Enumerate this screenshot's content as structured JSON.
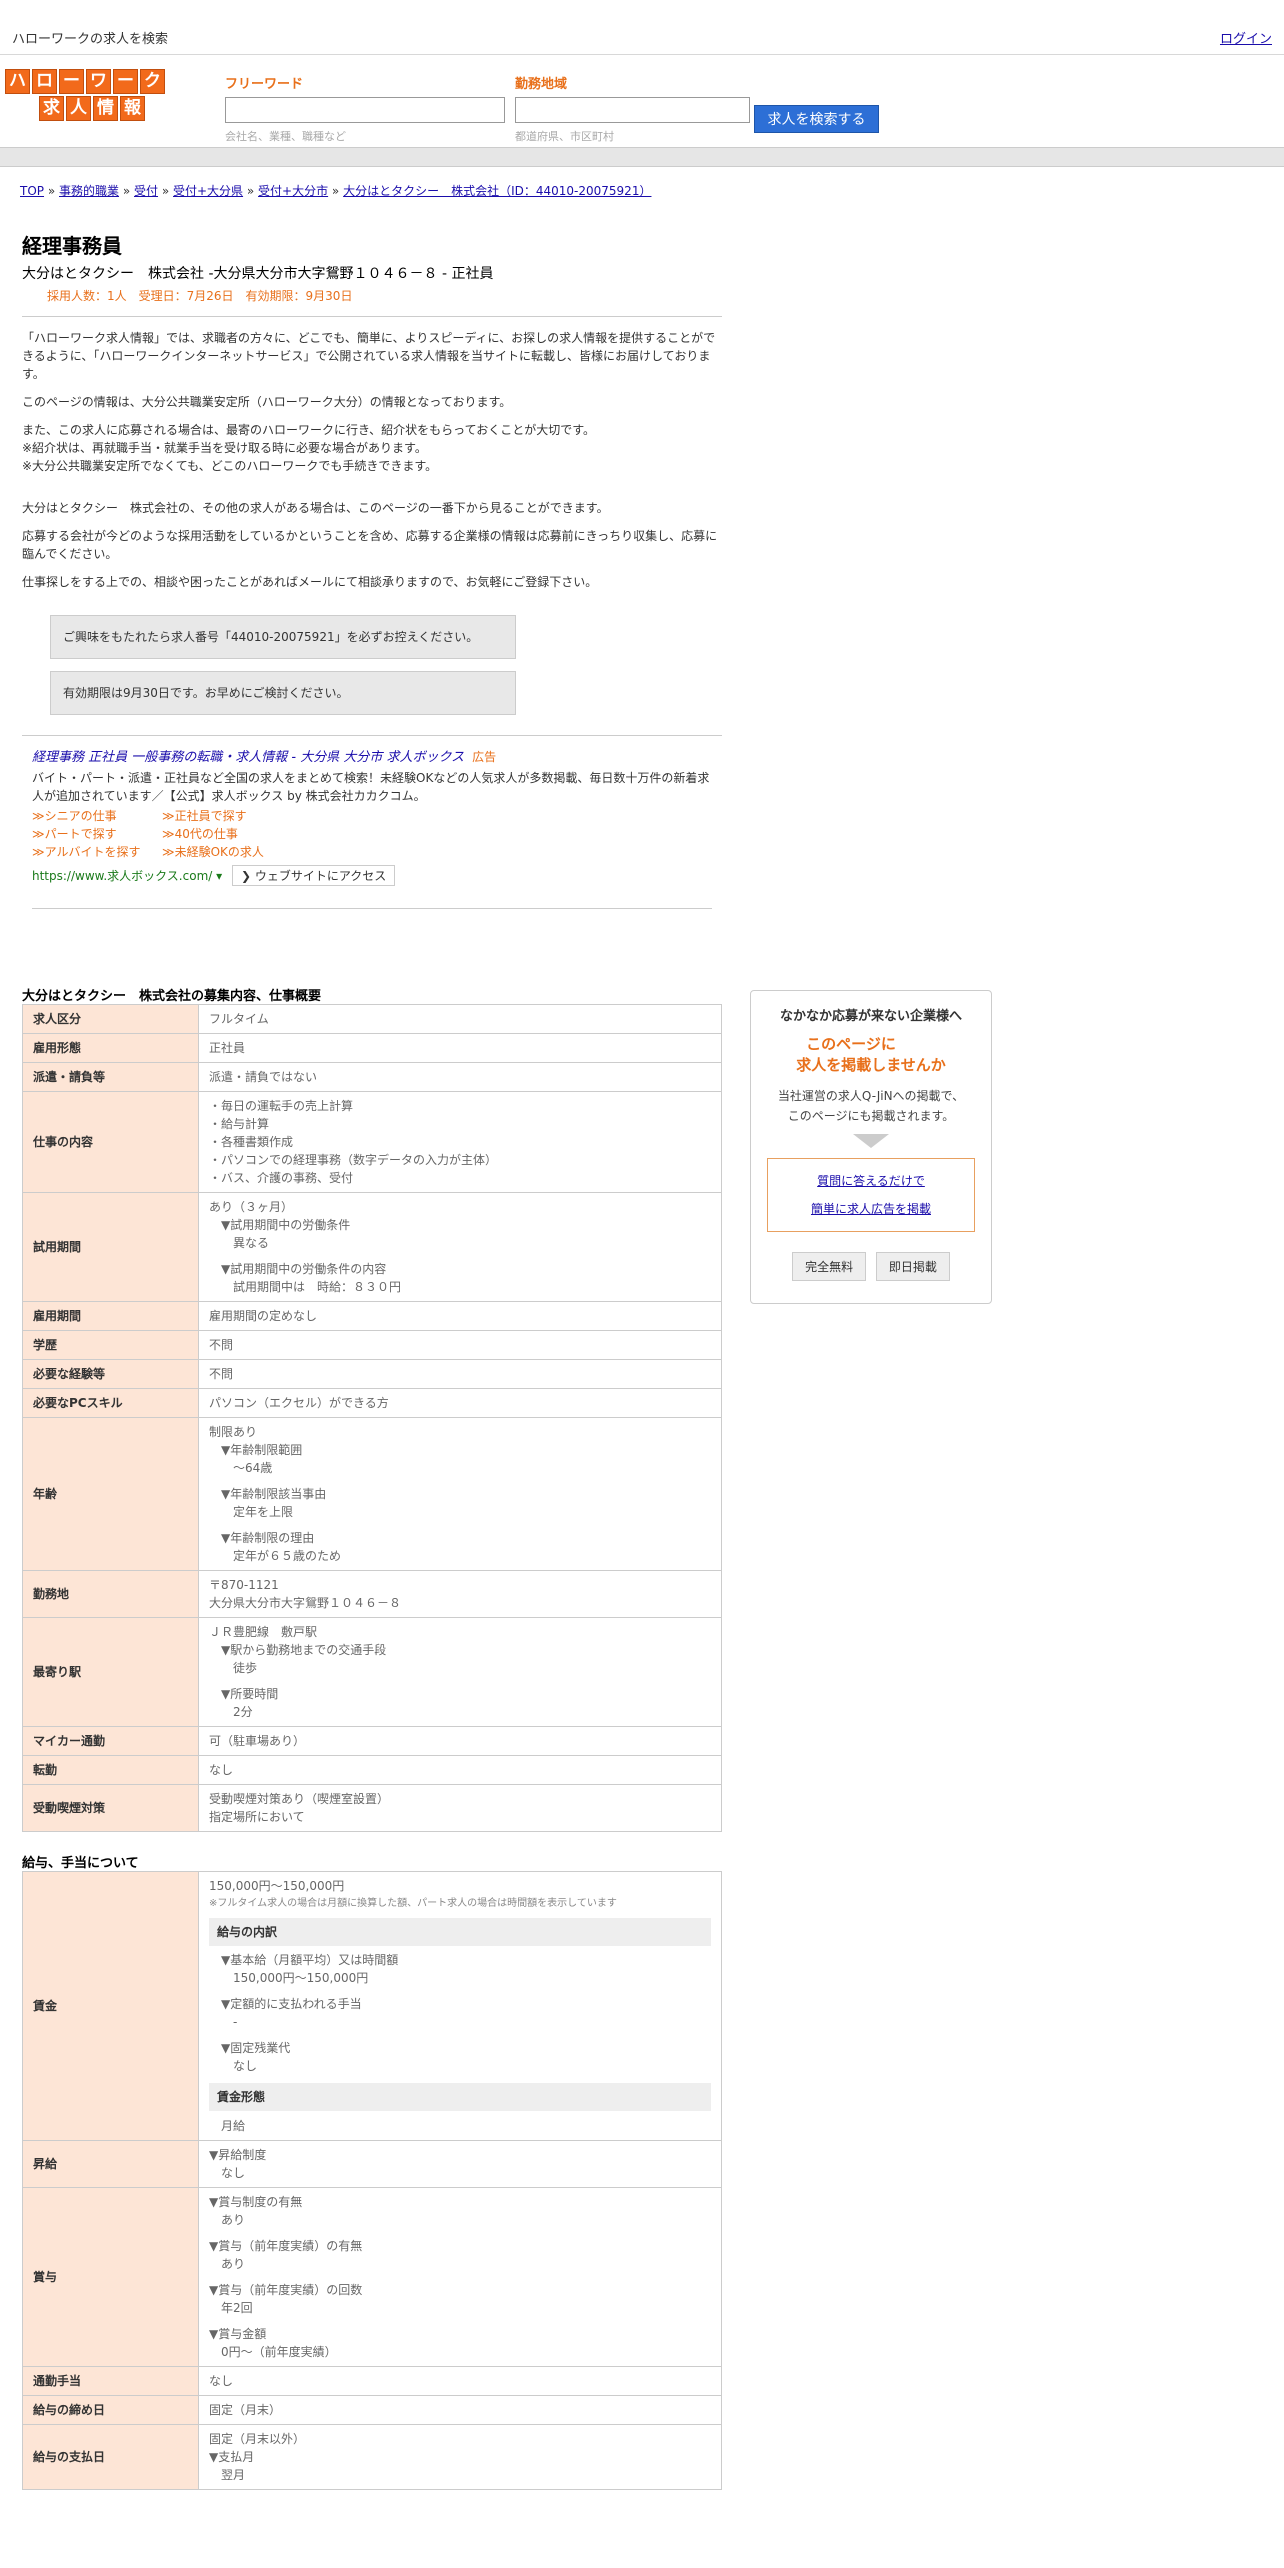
{
  "topbar": {
    "title": "ハローワークの求人を検索",
    "login": "ログイン"
  },
  "logo": {
    "top": [
      "ハ",
      "ロ",
      "ー",
      "ワ",
      "ー",
      "ク"
    ],
    "bottom": [
      "求",
      "人",
      "情",
      "報"
    ]
  },
  "search": {
    "keyword_label": "フリーワード",
    "keyword_hint": "会社名、業種、職種など",
    "area_label": "勤務地域",
    "area_hint": "都道府県、市区町村",
    "button": "求人を検索する"
  },
  "breadcrumb": [
    "TOP",
    "事務的職業",
    "受付",
    "受付+大分県",
    "受付+大分市",
    "大分はとタクシー　株式会社（ID：44010-20075921）"
  ],
  "job": {
    "title": "経理事務員",
    "subtitle": "大分はとタクシー　株式会社 -大分県大分市大字鴛野１０４６－８ - 正社員",
    "meta": "採用人数：1人　受理日：7月26日　有効期限：9月30日"
  },
  "intro": {
    "p1": "「ハローワーク求人情報」では、求職者の方々に、どこでも、簡単に、よりスピーディに、お探しの求人情報を提供することができるように、「ハローワークインターネットサービス」で公開されている求人情報を当サイトに転載し、皆様にお届けしております。",
    "p2": "このページの情報は、大分公共職業安定所（ハローワーク大分）の情報となっております。",
    "p3": "また、この求人に応募される場合は、最寄のハローワークに行き、紹介状をもらっておくことが大切です。",
    "p4": "※紹介状は、再就職手当・就業手当を受け取る時に必要な場合があります。",
    "p5": "※大分公共職業安定所でなくても、どこのハローワークでも手続きできます。",
    "p6": "大分はとタクシー　株式会社の、その他の求人がある場合は、このページの一番下から見ることができます。",
    "p7": "応募する会社が今どのような採用活動をしているかということを含め、応募する企業様の情報は応募前にきっちり収集し、応募に臨んでください。",
    "p8": "仕事探しをする上での、相談や困ったことがあればメールにて相談承りますので、お気軽にご登録下さい。"
  },
  "notes": [
    "ご興味をもたれたら求人番号「44010-20075921」を必ずお控えください。",
    "有効期限は9月30日です。お早めにご検討ください。"
  ],
  "ad": {
    "title": "経理事務 正社員 一般事務の転職・求人情報 - 大分県 大分市 求人ボックス",
    "label": "広告",
    "desc": "バイト・パート・派遣・正社員など全国の求人をまとめて検索！未経験OKなどの人気求人が多数掲載、毎日数十万件の新着求人が追加されています／【公式】求人ボックス by 株式会社カカクコム。",
    "links": [
      "≫シニアの仕事",
      "≫正社員で探す",
      "≫パートで探す",
      "≫40代の仕事",
      "≫アルバイトを探す",
      "≫未経験OKの求人"
    ],
    "url": "https://www.求人ボックス.com/",
    "visit": "❯ ウェブサイトにアクセス"
  },
  "section1": {
    "heading": "大分はとタクシー　株式会社の募集内容、仕事概要"
  },
  "section2": {
    "heading": "給与、手当について"
  },
  "rows": {
    "kubun": [
      "求人区分",
      "フルタイム"
    ],
    "koyou": [
      "雇用形態",
      "正社員"
    ],
    "haken": [
      "派遣・請負等",
      "派遣・請負ではない"
    ],
    "naiyou": [
      "仕事の内容",
      "・毎日の運転手の売上計算",
      "・給与計算",
      "・各種書類作成",
      "・パソコンでの経理事務（数字データの入力が主体）",
      "・バス、介護の事務、受付"
    ],
    "shiyou": [
      "試用期間",
      "あり（３ヶ月）",
      "▼試用期間中の労働条件",
      "異なる",
      "▼試用期間中の労働条件の内容",
      "試用期間中は　時給：８３０円"
    ],
    "kikan": [
      "雇用期間",
      "雇用期間の定めなし"
    ],
    "gakureki": [
      "学歴",
      "不問"
    ],
    "keiken": [
      "必要な経験等",
      "不問"
    ],
    "pc": [
      "必要なPCスキル",
      "パソコン（エクセル）ができる方"
    ],
    "nenrei": [
      "年齢",
      "制限あり",
      "▼年齢制限範囲",
      "〜64歳",
      "▼年齢制限該当事由",
      "定年を上限",
      "▼年齢制限の理由",
      "定年が６５歳のため"
    ],
    "kinmu": [
      "勤務地",
      "〒870-1121",
      "大分県大分市大字鴛野１０４６－８"
    ],
    "eki": [
      "最寄り駅",
      "ＪＲ豊肥線　敷戸駅",
      "▼駅から勤務地までの交通手段",
      "徒歩",
      "▼所要時間",
      "2分"
    ],
    "mycar": [
      "マイカー通勤",
      "可（駐車場あり）"
    ],
    "tenkin": [
      "転勤",
      "なし"
    ],
    "kitsuen": [
      "受動喫煙対策",
      "受動喫煙対策あり（喫煙室設置）",
      "指定場所において"
    ]
  },
  "wage": {
    "label": "賃金",
    "range": "150,000円〜150,000円",
    "note": "※フルタイム求人の場合は月額に換算した額、パート求人の場合は時間額を表示しています",
    "breakdown": "給与の内訳",
    "b1": "▼基本給（月額平均）又は時間額",
    "b1v": "150,000円〜150,000円",
    "b2": "▼定額的に支払われる手当",
    "b2v": "-",
    "b3": "▼固定残業代",
    "b3v": "なし",
    "form": "賃金形態",
    "formv": "月給"
  },
  "raise": [
    "昇給",
    "▼昇給制度",
    "なし"
  ],
  "bonus": [
    "賞与",
    "▼賞与制度の有無",
    "あり",
    "▼賞与（前年度実績）の有無",
    "あり",
    "▼賞与（前年度実績）の回数",
    "年2回",
    "▼賞与金額",
    "0円〜（前年度実績）"
  ],
  "commute": [
    "通勤手当",
    "なし"
  ],
  "closing": [
    "給与の締め日",
    "固定（月末）"
  ],
  "payday": [
    "給与の支払日",
    "固定（月末以外）",
    "▼支払月",
    "翌月"
  ],
  "sidebar": {
    "title": "なかなか応募が来ない企業様へ",
    "big1": "このページに",
    "big2": "求人を掲載しませんか",
    "desc1": "当社運営の求人Q-JiNへの掲載で、",
    "desc2": "このページにも掲載されます。",
    "link1": "質問に答えるだけで",
    "link2": "簡単に求人広告を掲載",
    "btn1": "完全無料",
    "btn2": "即日掲載"
  }
}
